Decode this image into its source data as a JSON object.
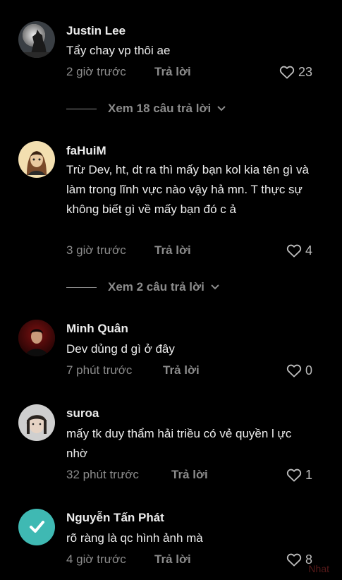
{
  "comments": [
    {
      "username": "Justin Lee",
      "text": "Tẩy chay vp thôi ae",
      "time": "2 giờ trước",
      "reply_label": "Trả lời",
      "likes": "23",
      "view_replies": "Xem 18 câu trả lời",
      "avatar": "wolf-moon-avatar"
    },
    {
      "username": "faHuiM",
      "text": "Trừ Dev, ht, dt ra thì mấy bạn kol kia tên gì và làm trong lĩnh vực nào vậy hả mn. T thực sự không biết gì về mấy bạn đó c ả",
      "time": "3 giờ trước",
      "reply_label": "Trả lời",
      "likes": "4",
      "view_replies": "Xem 2 câu trả lời",
      "avatar": "cartoon-portrait-avatar"
    },
    {
      "username": "Minh Quân",
      "text": "Dev dủng d gì ở đây",
      "time": "7 phút trước",
      "reply_label": "Trả lời",
      "likes": "0",
      "avatar": "dark-red-portrait-avatar"
    },
    {
      "username": "suroa",
      "text": "mấy tk duy thẩm hải triều có vẻ quyền l ực nhờ",
      "time": "32 phút trước",
      "reply_label": "Trả lời",
      "likes": "1",
      "avatar": "person-portrait-avatar"
    },
    {
      "username": "Nguyễn Tấn Phát",
      "text": "rõ ràng là qc hình ảnh mà",
      "time": "4 giờ trước",
      "reply_label": "Trả lời",
      "likes": "8",
      "avatar": "verified-check-avatar"
    }
  ],
  "watermark": "Nhat",
  "colors": {
    "background": "#000000",
    "secondary_text": "#8c8c8c",
    "teal_avatar": "#3fb9b3"
  },
  "icons": {
    "like": "heart-outline-icon",
    "expand": "chevron-down-icon"
  }
}
